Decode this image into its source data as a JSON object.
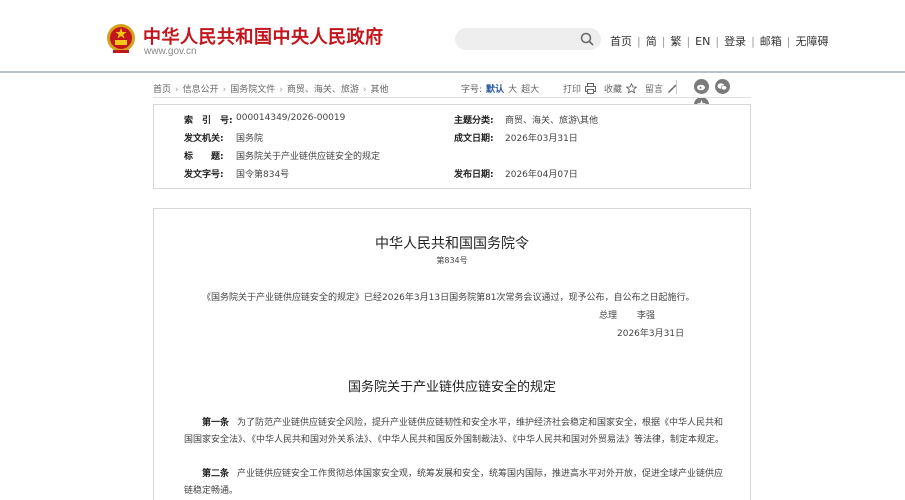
{
  "header": {
    "site_title": "中华人民共和国中央人民政府",
    "site_url": "www.gov.cn",
    "search_placeholder": "",
    "nav": [
      "首页",
      "简",
      "繁",
      "EN",
      "登录",
      "邮箱",
      "无障碍"
    ]
  },
  "breadcrumb": {
    "items": [
      "首页",
      "信息公开",
      "国务院文件",
      "商贸、海关、旅游",
      "其他"
    ],
    "font_size_label": "字号:",
    "font_sizes": [
      "默认",
      "大",
      "超大"
    ],
    "active_font_size": "默认",
    "print_label": "打印",
    "favorite_label": "收藏",
    "comment_label": "留言"
  },
  "meta": {
    "index_label": "索　引　号:",
    "index_value": "000014349/2026-00019",
    "category_label": "主题分类:",
    "category_value": "商贸、海关、旅游\\其他",
    "issuer_label": "发文机关:",
    "issuer_value": "国务院",
    "date_label": "成文日期:",
    "date_value": "2026年03月31日",
    "title_label": "标　　题:",
    "title_value": "国务院关于产业链供应链安全的规定",
    "docno_label": "发文字号:",
    "docno_value": "国令第834号",
    "pubdate_label": "发布日期:",
    "pubdate_value": "2026年04月07日"
  },
  "article": {
    "order_title": "中华人民共和国国务院令",
    "order_no": "第834号",
    "preamble": "《国务院关于产业链供应链安全的规定》已经2026年3月13日国务院第81次常务会议通过，现予公布，自公布之日起施行。",
    "premier_title": "总理",
    "premier_name": "李强",
    "sign_date": "2026年3月31日",
    "reg_title": "国务院关于产业链供应链安全的规定",
    "articles": [
      {
        "label": "第一条",
        "text": "为了防范产业链供应链安全风险，提升产业链供应链韧性和安全水平，维护经济社会稳定和国家安全，根据《中华人民共和国国家安全法》、《中华人民共和国对外关系法》、《中华人民共和国反外国制裁法》、《中华人民共和国对外贸易法》等法律，制定本规定。"
      },
      {
        "label": "第二条",
        "text": "产业链供应链安全工作贯彻总体国家安全观，统筹发展和安全，统筹国内国际，推进高水平对外开放，促进全球产业链供应链稳定畅通。"
      }
    ]
  },
  "colors": {
    "brand_red": "#c2161c",
    "header_rule": "#b9c4cf",
    "active_link": "#2a5b9c"
  },
  "icons": [
    "national-emblem",
    "search-icon",
    "printer-icon",
    "star-icon",
    "pencil-icon",
    "weibo-icon",
    "wechat-icon",
    "more-icon"
  ]
}
